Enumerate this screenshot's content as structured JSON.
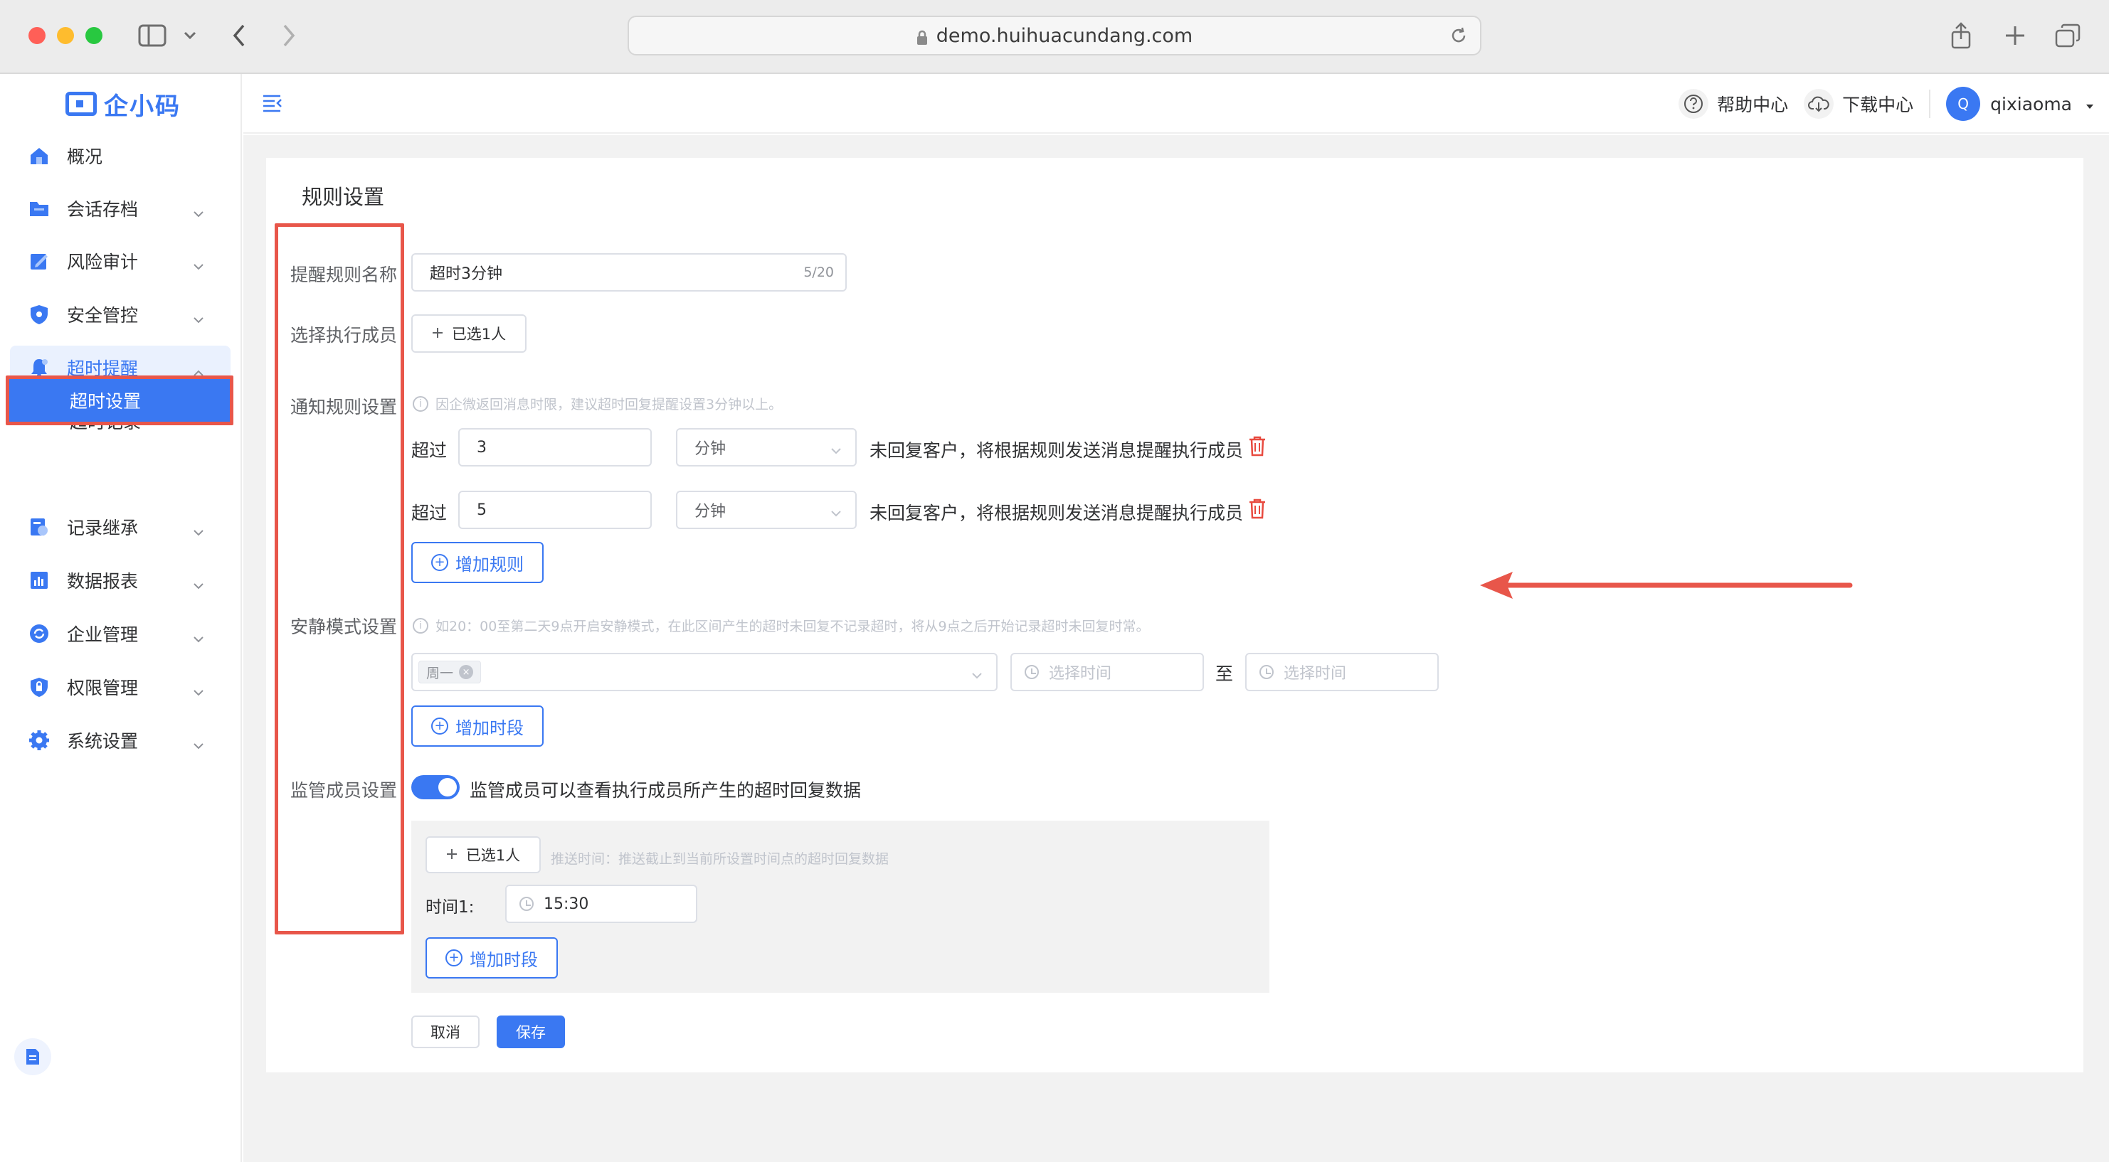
{
  "browser": {
    "url": "demo.huihuacundang.com"
  },
  "sidebar": {
    "logo_text": "企小码",
    "items": [
      {
        "label": "概况",
        "icon": "home-icon"
      },
      {
        "label": "会话存档",
        "icon": "folder-icon"
      },
      {
        "label": "风险审计",
        "icon": "edit-icon"
      },
      {
        "label": "安全管控",
        "icon": "shield-icon"
      },
      {
        "label": "超时提醒",
        "icon": "bell-icon"
      },
      {
        "label": "记录继承",
        "icon": "record-icon"
      },
      {
        "label": "数据报表",
        "icon": "chart-icon"
      },
      {
        "label": "企业管理",
        "icon": "cycle-icon"
      },
      {
        "label": "权限管理",
        "icon": "lock-shield-icon"
      },
      {
        "label": "系统设置",
        "icon": "gear-icon"
      }
    ],
    "sub_items": [
      {
        "label": "超时记录"
      },
      {
        "label": "超时设置"
      }
    ]
  },
  "topbar": {
    "help": "帮助中心",
    "download": "下载中心",
    "avatar_initial": "Q",
    "username": "qixiaoma"
  },
  "page": {
    "title": "规则设置",
    "labels": {
      "rule_name": "提醒规则名称",
      "members": "选择执行成员",
      "notify": "通知规则设置",
      "quiet": "安静模式设置",
      "supervisor": "监管成员设置"
    },
    "rule_name_value": "超时3分钟",
    "rule_name_counter": "5/20",
    "members_button": "已选1人",
    "notify_hint": "因企微返回消息时限，建议超时回复提醒设置3分钟以上。",
    "rules": [
      {
        "prefix": "超过",
        "value": "3",
        "unit": "分钟",
        "suffix": "未回复客户，将根据规则发送消息提醒执行成员"
      },
      {
        "prefix": "超过",
        "value": "5",
        "unit": "分钟",
        "suffix": "未回复客户，将根据规则发送消息提醒执行成员"
      }
    ],
    "add_rule": "增加规则",
    "quiet_hint": "如20：00至第二天9点开启安静模式，在此区间产生的超时未回复不记录超时，将从9点之后开始记录超时未回复时常。",
    "quiet_day_tag": "周一",
    "time_start_placeholder": "选择时间",
    "time_to": "至",
    "time_end_placeholder": "选择时间",
    "add_period": "增加时段",
    "supervisor_toggle_text": "监管成员可以查看执行成员所产生的超时回复数据",
    "supervisor_members_button": "已选1人",
    "push_hint": "推送时间：推送截止到当前所设置时间点的超时回复数据",
    "time1_label": "时间1:",
    "time1_value": "15:30",
    "add_period2": "增加时段",
    "cancel": "取消",
    "save": "保存"
  },
  "colors": {
    "accent": "#3a78f2",
    "annotation_red": "#e8564a",
    "delete_red": "#e84a3f"
  }
}
